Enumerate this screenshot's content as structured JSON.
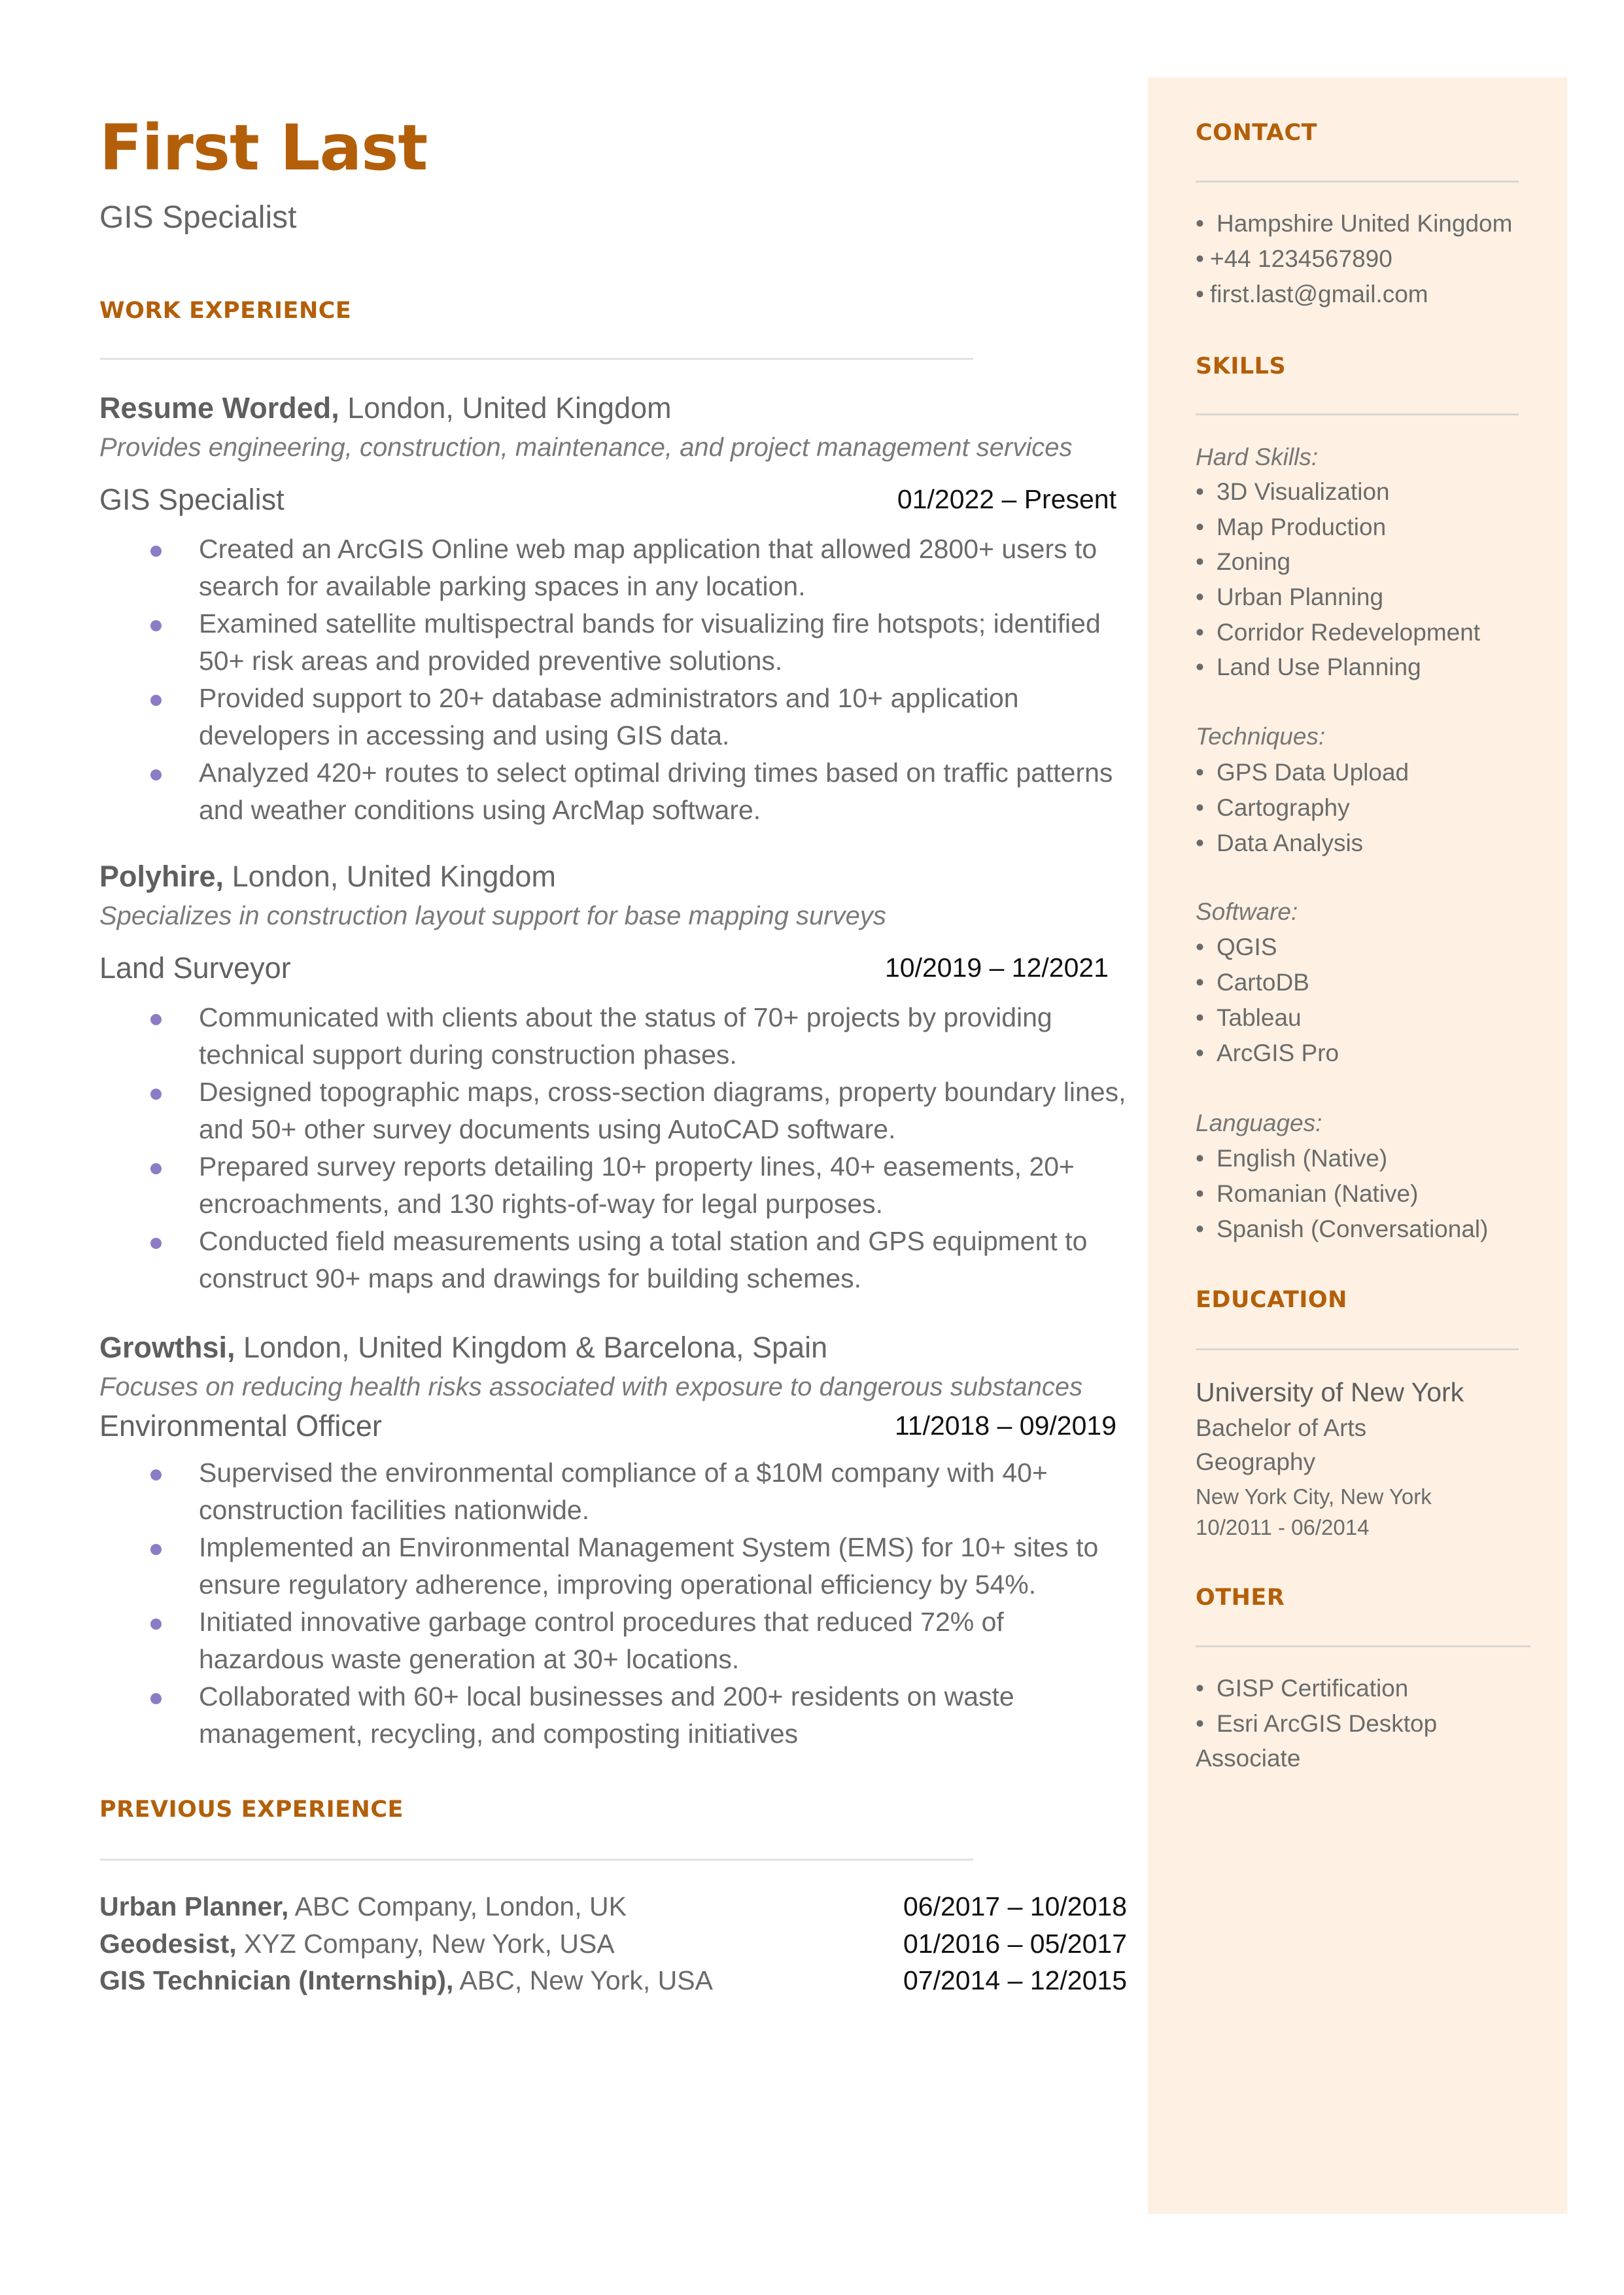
{
  "header": {
    "name": "First Last",
    "headline": "GIS Specialist"
  },
  "colors": {
    "accent": "#b35f0a",
    "bullet": "#8c7cc6",
    "sidebar_bg": "#fef1e3",
    "body_text": "#666666"
  },
  "work_experience": {
    "title": "WORK EXPERIENCE",
    "jobs": [
      {
        "company": "Resume Worded,",
        "location": " London, United Kingdom",
        "description": "Provides engineering, construction, maintenance, and project management services",
        "role": "GIS Specialist",
        "dates": "01/2022 – Present",
        "bullets": [
          "Created an ArcGIS Online web map application that allowed 2800+ users to search for available parking spaces in any location.",
          "Examined satellite multispectral bands for visualizing fire hotspots; identified 50+ risk areas and provided preventive solutions.",
          "Provided support to 20+ database administrators and 10+ application developers in accessing and using GIS data.",
          "Analyzed 420+ routes to select optimal driving times based on traffic patterns and weather conditions using ArcMap software."
        ]
      },
      {
        "company": "Polyhire,",
        "location": " London, United Kingdom",
        "description": "Specializes in construction layout support for base mapping surveys",
        "role": "Land Surveyor",
        "dates": "10/2019 – 12/2021",
        "bullets": [
          "Communicated with clients about the status of 70+ projects by providing technical support during construction phases.",
          "Designed topographic maps, cross-section diagrams, property boundary lines, and 50+ other survey documents using AutoCAD software.",
          "Prepared survey reports detailing 10+ property lines, 40+ easements, 20+ encroachments, and 130 rights-of-way for legal purposes.",
          "Conducted field measurements using a total station and GPS equipment to construct 90+ maps and drawings for building schemes."
        ]
      },
      {
        "company": "Growthsi,",
        "location": " London, United Kingdom & Barcelona, Spain",
        "description": "Focuses on reducing health risks associated with exposure to dangerous substances",
        "role": "Environmental Officer",
        "dates": "11/2018 – 09/2019",
        "bullets": [
          "Supervised the environmental compliance of a $10M  company with 40+ construction facilities nationwide.",
          "Implemented an Environmental Management System (EMS) for 10+ sites to ensure regulatory adherence, improving operational efficiency by 54%.",
          "Initiated innovative garbage control procedures that reduced 72% of hazardous waste generation at 30+ locations.",
          "Collaborated with 60+ local businesses and 200+ residents on waste management, recycling, and composting initiatives"
        ]
      }
    ]
  },
  "previous_experience": {
    "title": "PREVIOUS EXPERIENCE",
    "rows": [
      {
        "role": "Urban Planner,",
        "detail": " ABC Company, London, UK",
        "dates": "06/2017 – 10/2018"
      },
      {
        "role": "Geodesist,",
        "detail": " XYZ Company, New York, USA",
        "dates": "01/2016 – 05/2017"
      },
      {
        "role": "GIS Technician (Internship),",
        "detail": " ABC, New York, USA",
        "dates": "07/2014 – 12/2015"
      }
    ]
  },
  "sidebar": {
    "contact": {
      "title": "CONTACT",
      "items": [
        "Hampshire United Kingdom",
        "+44 1234567890",
        "first.last@gmail.com"
      ]
    },
    "skills": {
      "title": "SKILLS",
      "groups": [
        {
          "label": "Hard Skills:",
          "items": [
            "3D Visualization",
            "Map Production",
            "Zoning",
            "Urban Planning",
            "Corridor Redevelopment",
            "Land Use Planning"
          ]
        },
        {
          "label": "Techniques:",
          "items": [
            "GPS Data Upload",
            "Cartography",
            "Data Analysis"
          ]
        },
        {
          "label": "Software:",
          "items": [
            "QGIS",
            "CartoDB",
            "Tableau",
            "ArcGIS Pro"
          ]
        },
        {
          "label": "Languages:",
          "items": [
            "English (Native)",
            "Romanian (Native)",
            "Spanish (Conversational)"
          ]
        }
      ]
    },
    "education": {
      "title": "EDUCATION",
      "school": "University of New York",
      "degree": "Bachelor of Arts",
      "field": "Geography",
      "location": "New York City, New York",
      "dates": "10/2011 - 06/2014"
    },
    "other": {
      "title": "OTHER",
      "items": [
        "GISP Certification",
        "Esri ArcGIS Desktop"
      ],
      "continuation": "Associate"
    }
  }
}
